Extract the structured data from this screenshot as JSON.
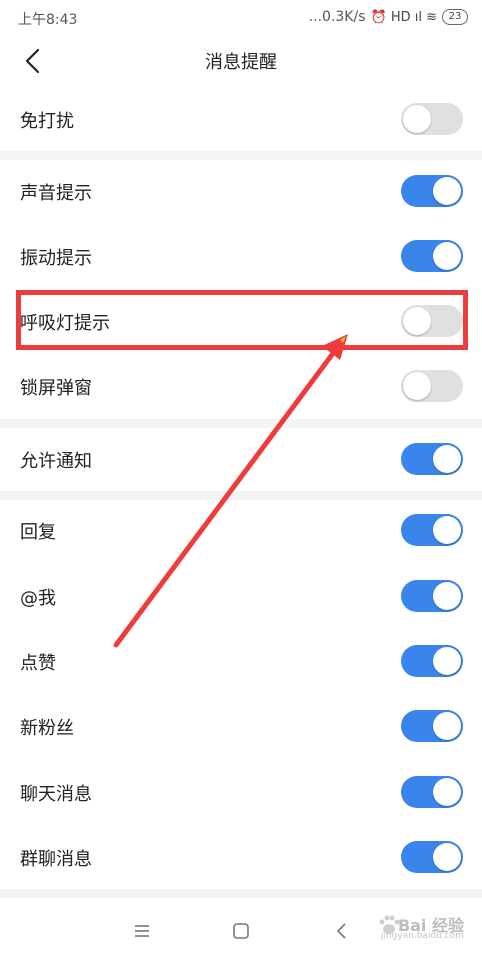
{
  "status_bar": {
    "time": "上午8:43",
    "speed": "...0.3K/s",
    "icons": "⏰ HD ıl ≋",
    "battery": "23"
  },
  "header": {
    "title": "消息提醒",
    "back_icon": "chevron-left-icon"
  },
  "settings": [
    {
      "label": "免打扰",
      "on": false
    },
    {
      "label": "声音提示",
      "on": true
    },
    {
      "label": "振动提示",
      "on": true
    },
    {
      "label": "呼吸灯提示",
      "on": false
    },
    {
      "label": "锁屏弹窗",
      "on": false
    },
    {
      "label": "允许通知",
      "on": true
    },
    {
      "label": "回复",
      "on": true
    },
    {
      "label": "@我",
      "on": true
    },
    {
      "label": "点赞",
      "on": true
    },
    {
      "label": "新粉丝",
      "on": true
    },
    {
      "label": "聊天消息",
      "on": true
    },
    {
      "label": "群聊消息",
      "on": true
    }
  ],
  "colors": {
    "toggle_on": "#3a85ec",
    "toggle_off": "#e0e0e0",
    "annotation": "#ee3b3b"
  },
  "bottom_nav": [
    "menu-icon",
    "home-icon",
    "back-icon"
  ],
  "watermark": {
    "main": "Bai 经验",
    "sub": "jingyan.baidu.com"
  }
}
